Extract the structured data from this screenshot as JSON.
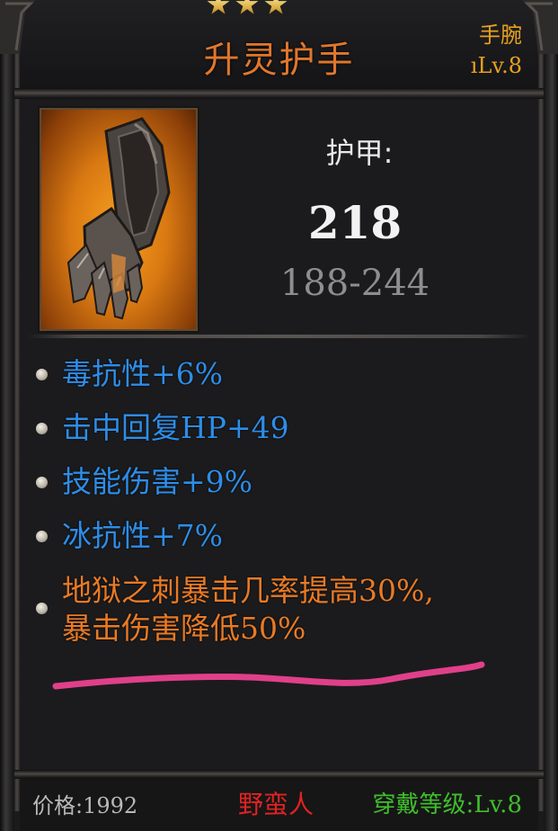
{
  "item": {
    "stars": 3,
    "name": "升灵护手",
    "slot": "手腕",
    "item_level": "ıLv.8"
  },
  "stats": {
    "armor_label": "护甲:",
    "armor_value": "218",
    "armor_range": "188-244"
  },
  "affixes": [
    {
      "text": "毒抗性+6%",
      "type": "magic"
    },
    {
      "text": "击中回复HP+49",
      "type": "magic"
    },
    {
      "text": "技能伤害+9%",
      "type": "magic"
    },
    {
      "text": "冰抗性+7%",
      "type": "magic"
    },
    {
      "text_line1": "地狱之刺暴击几率提高30%,",
      "text_line2": "暴击伤害降低50%",
      "type": "legendary"
    }
  ],
  "footer": {
    "price_label": "价格:",
    "price_value": "1992",
    "class": "野蛮人",
    "require_label": "穿戴等级:",
    "require_value": "Lv.8"
  },
  "colors": {
    "title": "#e1772c",
    "magic_affix": "#2e8de8",
    "legendary_affix": "#e87a26",
    "class": "#e02222",
    "requirement": "#3fbf2a",
    "annotation_underline": "#e0408a"
  },
  "icons": {
    "item": "gauntlet-icon",
    "star": "star-icon",
    "bullet": "affix-bullet-icon"
  }
}
